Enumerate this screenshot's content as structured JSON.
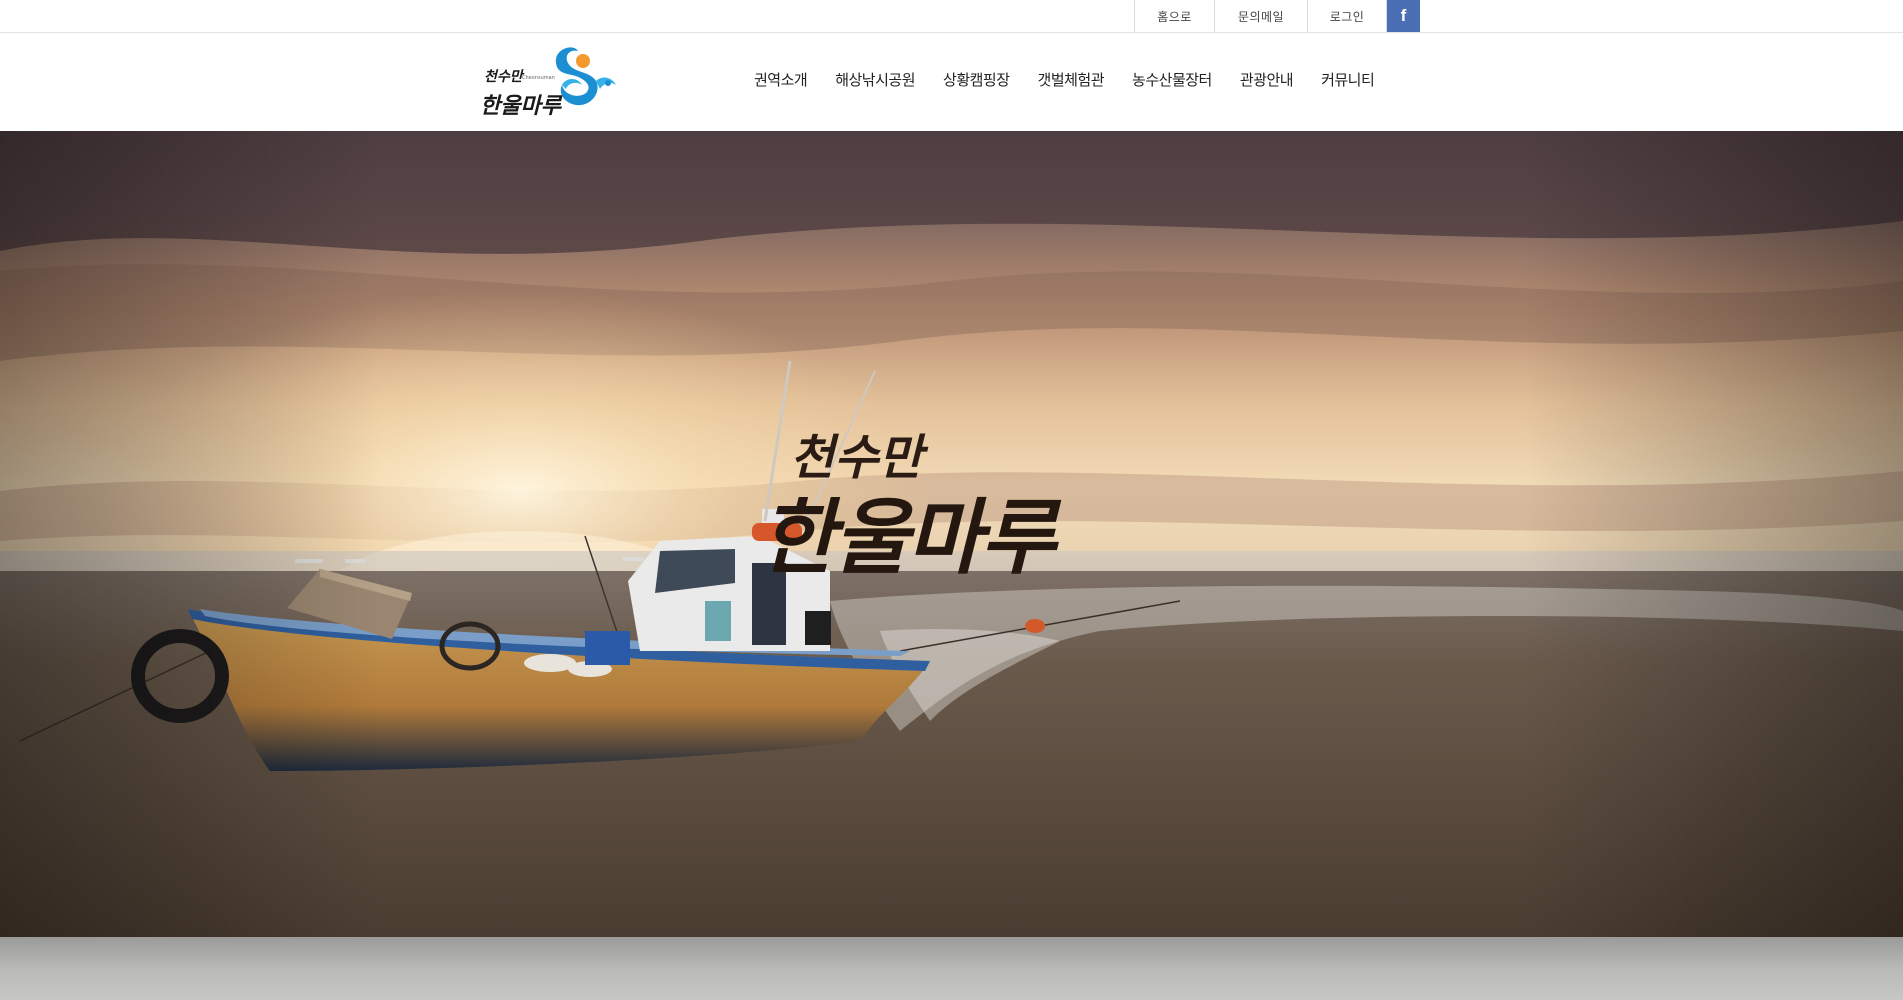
{
  "utility_links": {
    "home": "홈으로",
    "contact": "문의메일",
    "login": "로그인",
    "facebook_glyph": "f",
    "facebook_color": "#4a6fb5"
  },
  "logo": {
    "title_top": "천수만",
    "title_main": "한울마루",
    "small_text": "Cheonsuman"
  },
  "gnb": [
    "권역소개",
    "해상낚시공원",
    "상황캠핑장",
    "갯벌체험관",
    "농수산물장터",
    "관광안내",
    "커뮤니티"
  ],
  "hero": {
    "title_top": "천수만",
    "title_main": "한울마루"
  }
}
